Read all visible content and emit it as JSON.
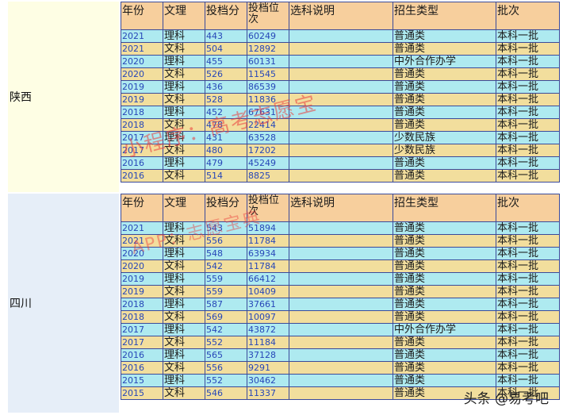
{
  "columns": [
    "年份",
    "文理",
    "投档分",
    "投档位次",
    "选科说明",
    "招生类型",
    "批次"
  ],
  "provinces": [
    {
      "name": "陕西",
      "rows": [
        [
          "2021",
          "理科",
          "443",
          "60249",
          "",
          "普通类",
          "本科一批"
        ],
        [
          "2021",
          "文科",
          "504",
          "12892",
          "",
          "普通类",
          "本科一批"
        ],
        [
          "2020",
          "理科",
          "455",
          "60131",
          "",
          "中外合作办学",
          "本科一批"
        ],
        [
          "2020",
          "文科",
          "526",
          "11545",
          "",
          "普通类",
          "本科一批"
        ],
        [
          "2019",
          "理科",
          "436",
          "86539",
          "",
          "普通类",
          "本科一批"
        ],
        [
          "2019",
          "文科",
          "528",
          "11836",
          "",
          "普通类",
          "本科一批"
        ],
        [
          "2018",
          "理科",
          "452",
          "67631",
          "",
          "普通类",
          "本科一批"
        ],
        [
          "2018",
          "文科",
          "478",
          "22414",
          "",
          "普通类",
          "本科一批"
        ],
        [
          "2017",
          "理科",
          "431",
          "63528",
          "",
          "少数民族",
          "本科一批"
        ],
        [
          "2017",
          "文科",
          "480",
          "17202",
          "",
          "少数民族",
          "本科一批"
        ],
        [
          "2016",
          "理科",
          "479",
          "45249",
          "",
          "普通类",
          "本科一批"
        ],
        [
          "2016",
          "文科",
          "514",
          "8825",
          "",
          "普通类",
          "本科一批"
        ]
      ]
    },
    {
      "name": "四川",
      "rows": [
        [
          "2021",
          "理科",
          "543",
          "51894",
          "",
          "普通类",
          "本科一批"
        ],
        [
          "2021",
          "文科",
          "556",
          "11784",
          "",
          "普通类",
          "本科一批"
        ],
        [
          "2020",
          "理科",
          "548",
          "63934",
          "",
          "普通类",
          "本科一批"
        ],
        [
          "2020",
          "文科",
          "542",
          "11784",
          "",
          "普通类",
          "本科一批"
        ],
        [
          "2019",
          "理科",
          "559",
          "66412",
          "",
          "普通类",
          "本科一批"
        ],
        [
          "2019",
          "文科",
          "559",
          "10409",
          "",
          "普通类",
          "本科一批"
        ],
        [
          "2018",
          "理科",
          "587",
          "37661",
          "",
          "普通类",
          "本科一批"
        ],
        [
          "2018",
          "文科",
          "569",
          "10097",
          "",
          "普通类",
          "本科一批"
        ],
        [
          "2017",
          "理科",
          "542",
          "43872",
          "",
          "中外合作办学",
          "本科一批"
        ],
        [
          "2017",
          "文科",
          "552",
          "11184",
          "",
          "普通类",
          "本科一批"
        ],
        [
          "2016",
          "理科",
          "565",
          "37128",
          "",
          "普通类",
          "本科一批"
        ],
        [
          "2016",
          "文科",
          "556",
          "9291",
          "",
          "普通类",
          "本科一批"
        ],
        [
          "2015",
          "理科",
          "552",
          "30462",
          "",
          "普通类",
          "本科一批"
        ],
        [
          "2015",
          "文科",
          "546",
          "11337",
          "",
          "普通类",
          "本科一批"
        ]
      ]
    }
  ],
  "watermark": {
    "line1": "小程序：高考志愿宝",
    "line2": "APP：志愿宝典"
  },
  "attribution": "头条 @易考吧"
}
